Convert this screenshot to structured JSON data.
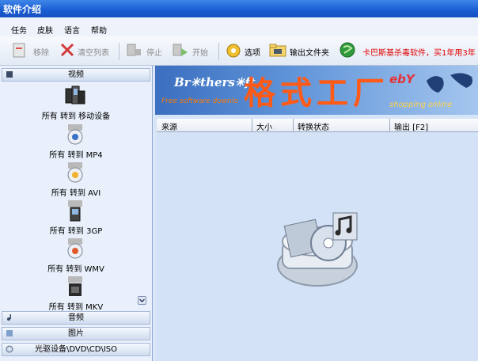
{
  "window": {
    "title": "软件介绍"
  },
  "menu": [
    "任务",
    "皮肤",
    "语言",
    "帮助"
  ],
  "toolbar": {
    "remove": "移除",
    "clear": "清空列表",
    "stop": "停止",
    "start": "开始",
    "options": "选项",
    "output_folder": "输出文件夹",
    "promo": "卡巴斯基杀毒软件，买1年用3年"
  },
  "sidebar": {
    "video_header": "视频",
    "video_items": [
      {
        "label": "所有 转到 移动设备",
        "icon": "mobile-device-icon"
      },
      {
        "label": "所有 转到 MP4",
        "badge": "MP4"
      },
      {
        "label": "所有 转到 AVI",
        "badge": "AVI"
      },
      {
        "label": "所有 转到 3GP",
        "badge": "3GP"
      },
      {
        "label": "所有 转到 WMV",
        "badge": "WMV"
      },
      {
        "label": "所有 转到 MKV",
        "badge": "MKV"
      }
    ],
    "audio_header": "音频",
    "picture_header": "图片",
    "disc_header": "光驱设备\\DVD\\CD\\ISO"
  },
  "banner": {
    "brothers": "Br✳thers✳ft",
    "free": "Free software downlo",
    "app_name": "格式工厂",
    "ebay": "ebY",
    "shopping": "shopping online"
  },
  "grid": {
    "columns": [
      "来源",
      "大小",
      "转换状态",
      "输出 [F2]"
    ]
  }
}
